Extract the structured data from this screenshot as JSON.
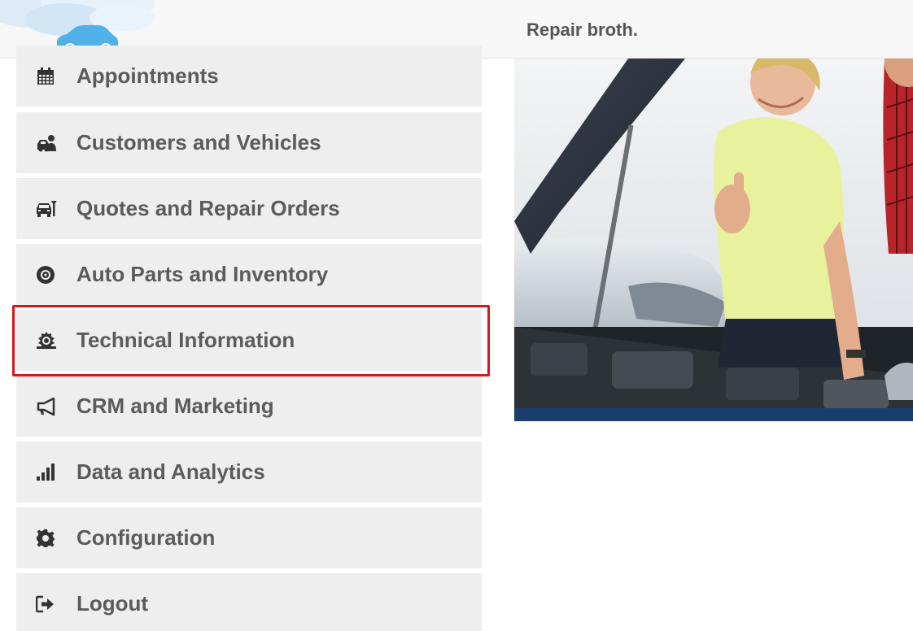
{
  "header": {
    "shop_name": "Repair broth."
  },
  "menu": {
    "items": [
      {
        "label": "Appointments",
        "icon": "calendar-icon"
      },
      {
        "label": "Customers and Vehicles",
        "icon": "customer-vehicle-icon"
      },
      {
        "label": "Quotes and Repair Orders",
        "icon": "repair-order-icon"
      },
      {
        "label": "Auto Parts and Inventory",
        "icon": "brake-disc-icon"
      },
      {
        "label": "Technical Information",
        "icon": "technical-info-icon"
      },
      {
        "label": "CRM and Marketing",
        "icon": "megaphone-icon"
      },
      {
        "label": "Data and Analytics",
        "icon": "bar-chart-icon"
      },
      {
        "label": "Configuration",
        "icon": "gear-icon"
      },
      {
        "label": "Logout",
        "icon": "logout-icon"
      }
    ],
    "highlighted_item": "Technical Information"
  },
  "colors": {
    "menu_background": "#eeeeee",
    "menu_text": "#5b5b5b",
    "highlight_border": "#d9151b",
    "logo_car": "#4fb1e8"
  }
}
